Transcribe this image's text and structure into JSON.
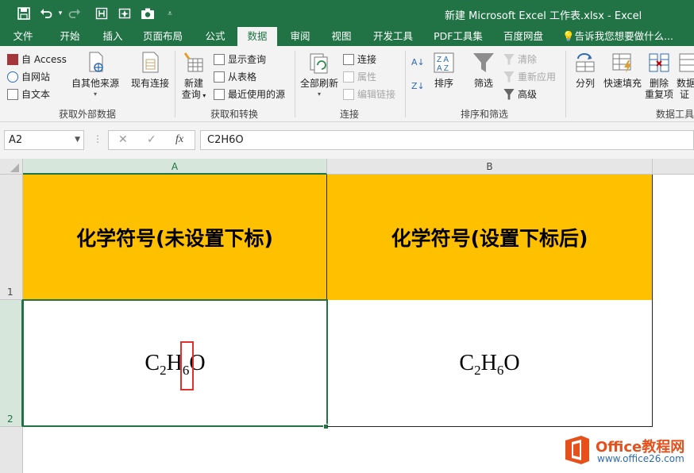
{
  "window": {
    "title": "新建 Microsoft Excel 工作表.xlsx  -  Excel"
  },
  "quick_access": {
    "save_icon": "save-icon",
    "undo_icon": "undo-icon",
    "redo_icon": "redo-icon",
    "touch_icon": "touch-mode-icon",
    "pin_icon": "pin-icon",
    "camera_icon": "camera-icon",
    "more_icon": "customize-icon"
  },
  "tabs": [
    "文件",
    "开始",
    "插入",
    "页面布局",
    "公式",
    "数据",
    "审阅",
    "视图",
    "开发工具",
    "PDF工具集",
    "百度网盘"
  ],
  "active_tab": "数据",
  "tell_me": "告诉我您想要做什么...",
  "ribbon": {
    "get_external": {
      "access": "自 Access",
      "web": "自网站",
      "text": "自文本",
      "other_sources": "自其他来源",
      "existing_connections": "现有连接",
      "group_label": "获取外部数据"
    },
    "get_transform": {
      "new_query": "新建",
      "new_query_line2": "查询",
      "show_queries": "显示查询",
      "from_table": "从表格",
      "recent_sources": "最近使用的源",
      "group_label": "获取和转换"
    },
    "connections": {
      "refresh_all": "全部刷新",
      "connections": "连接",
      "properties": "属性",
      "edit_links": "编辑链接",
      "group_label": "连接"
    },
    "sort_filter": {
      "sort": "排序",
      "filter": "筛选",
      "clear": "清除",
      "reapply": "重新应用",
      "advanced": "高级",
      "group_label": "排序和筛选"
    },
    "data_tools": {
      "split": "分列",
      "flash_fill": "快速填充",
      "remove_duplicates": "删除",
      "remove_duplicates_line2": "重复项",
      "data_validation": "数据",
      "data_validation_line2": "证",
      "group_label": "数据工具"
    }
  },
  "formula_bar": {
    "name_box": "A2",
    "cancel": "✕",
    "enter": "✓",
    "fx": "fx",
    "content": "C2H6O"
  },
  "sheet": {
    "columns": [
      "A",
      "B"
    ],
    "rows": [
      "1",
      "2"
    ],
    "header_fill": "#ffc000",
    "cells": {
      "A1": "化学符号(未设置下标)",
      "B1": "化学符号(设置下标后)",
      "A2": {
        "p1": "C",
        "s1": "2",
        "p2": "H",
        "s2": "6",
        "p3": "O"
      },
      "B2": {
        "p1": "C",
        "s1": "2",
        "p2": "H",
        "s2": "6",
        "p3": "O"
      }
    }
  },
  "watermark": {
    "name": "Office教程网",
    "url": "www.office26.com"
  },
  "colors": {
    "excel_green": "#217346",
    "highlight_red": "#e03030",
    "selection_green": "#217346"
  }
}
